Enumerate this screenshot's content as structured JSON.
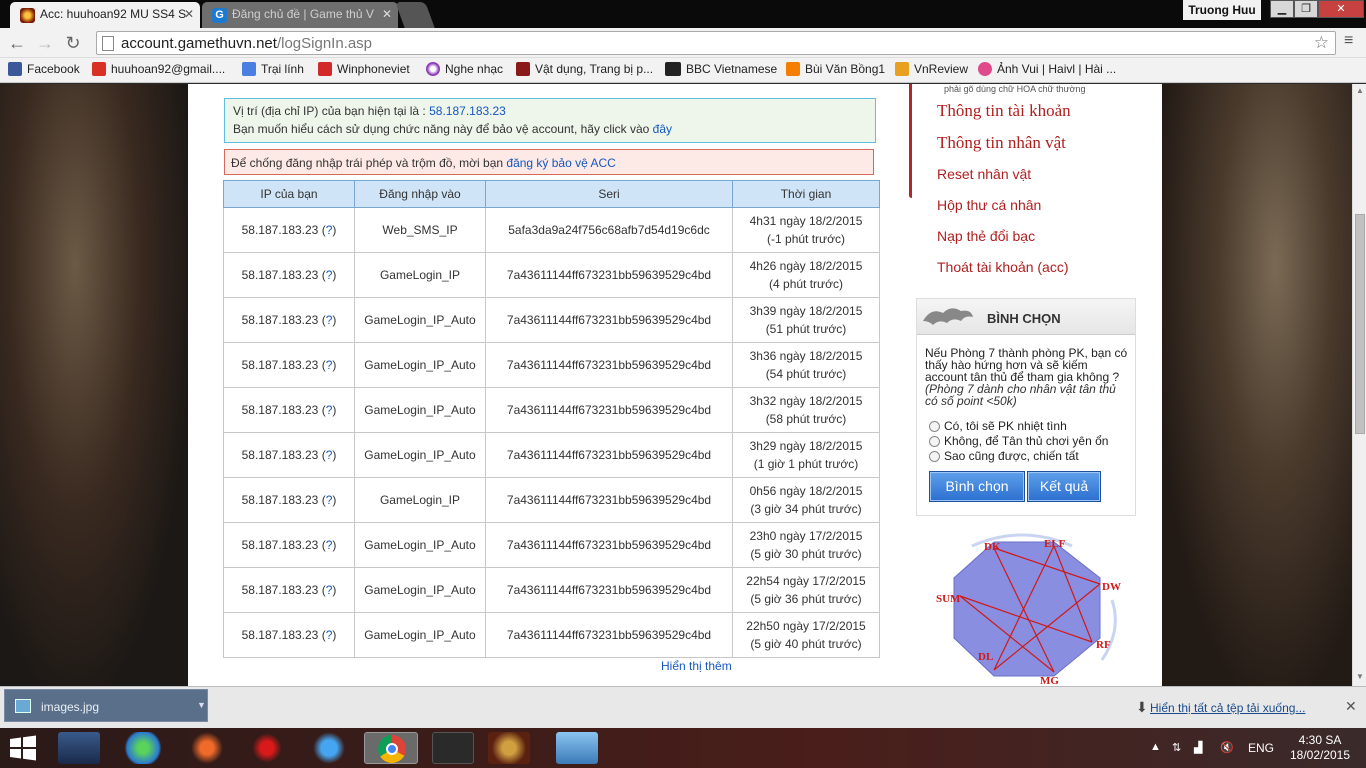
{
  "browser": {
    "tabs": [
      {
        "label": "Acc: huuhoan92 MU SS4 S",
        "active": true
      },
      {
        "label": "Đăng chủ đề | Game thủ V",
        "active": false
      }
    ],
    "user_badge": "Truong Huu",
    "url_host": "account.gamethuvn.net",
    "url_path": "/logSignIn.asp",
    "bookmarks": [
      "Facebook",
      "huuhoan92@gmail....",
      "Trại lính",
      "Winphoneviet",
      "Nghe nhạc",
      "Vật dụng, Trang bị p...",
      "BBC Vietnamese",
      "Bùi Văn Bồng1",
      "VnReview",
      "Ảnh Vui | Haivl | Hài ..."
    ]
  },
  "page": {
    "ip_notice_prefix": "Vị trí (địa chỉ IP) của bạn hiện tại là :",
    "ip_value": "58.187.183.23",
    "ip_notice_line2": "Bạn muốn hiểu cách sử dụng chức năng này để bảo vệ account, hãy click vào",
    "ip_notice_link": "đây",
    "warn_text": "Để chống đăng nhập trái phép và trộm đồ, mời bạn",
    "warn_link": "đăng ký bảo vệ ACC",
    "table": {
      "headers": [
        "IP của bạn",
        "Đăng nhập vào",
        "Seri",
        "Thời gian"
      ],
      "rows": [
        {
          "ip": "58.187.183.23",
          "q": "(?)",
          "login": "Web_SMS_IP",
          "seri": "5afa3da9a24f756c68afb7d54d19c6dc",
          "time": "4h31 ngày 18/2/2015",
          "ago": "(-1 phút trước)"
        },
        {
          "ip": "58.187.183.23",
          "q": "(?)",
          "login": "GameLogin_IP",
          "seri": "7a43611144ff673231bb59639529c4bd",
          "time": "4h26 ngày 18/2/2015",
          "ago": "(4 phút trước)"
        },
        {
          "ip": "58.187.183.23",
          "q": "(?)",
          "login": "GameLogin_IP_Auto",
          "seri": "7a43611144ff673231bb59639529c4bd",
          "time": "3h39 ngày 18/2/2015",
          "ago": "(51 phút trước)"
        },
        {
          "ip": "58.187.183.23",
          "q": "(?)",
          "login": "GameLogin_IP_Auto",
          "seri": "7a43611144ff673231bb59639529c4bd",
          "time": "3h36 ngày 18/2/2015",
          "ago": "(54 phút trước)"
        },
        {
          "ip": "58.187.183.23",
          "q": "(?)",
          "login": "GameLogin_IP_Auto",
          "seri": "7a43611144ff673231bb59639529c4bd",
          "time": "3h32 ngày 18/2/2015",
          "ago": "(58 phút trước)"
        },
        {
          "ip": "58.187.183.23",
          "q": "(?)",
          "login": "GameLogin_IP_Auto",
          "seri": "7a43611144ff673231bb59639529c4bd",
          "time": "3h29 ngày 18/2/2015",
          "ago": "(1 giờ 1 phút trước)"
        },
        {
          "ip": "58.187.183.23",
          "q": "(?)",
          "login": "GameLogin_IP",
          "seri": "7a43611144ff673231bb59639529c4bd",
          "time": "0h56 ngày 18/2/2015",
          "ago": "(3 giờ 34 phút trước)"
        },
        {
          "ip": "58.187.183.23",
          "q": "(?)",
          "login": "GameLogin_IP_Auto",
          "seri": "7a43611144ff673231bb59639529c4bd",
          "time": "23h0 ngày 17/2/2015",
          "ago": "(5 giờ 30 phút trước)"
        },
        {
          "ip": "58.187.183.23",
          "q": "(?)",
          "login": "GameLogin_IP_Auto",
          "seri": "7a43611144ff673231bb59639529c4bd",
          "time": "22h54 ngày 17/2/2015",
          "ago": "(5 giờ 36 phút trước)"
        },
        {
          "ip": "58.187.183.23",
          "q": "(?)",
          "login": "GameLogin_IP_Auto",
          "seri": "7a43611144ff673231bb59639529c4bd",
          "time": "22h50 ngày 17/2/2015",
          "ago": "(5 giờ 40 phút trước)"
        }
      ]
    },
    "show_more": "Hiển thị thêm"
  },
  "sidebar": {
    "note": "phải gõ dùng chữ HOA chữ thường",
    "links": [
      "Thông tin tài khoản",
      "Thông tin nhân vật",
      "Reset nhân vật",
      "Hộp thư cá nhân",
      "Nạp thẻ đổi bạc",
      "Thoát tài khoản (acc)"
    ],
    "poll": {
      "title": "BÌNH CHỌN",
      "question": "Nếu Phòng 7 thành phòng PK, bạn có thấy hào hứng hơn và sẽ kiếm account tân thủ để tham gia không ?",
      "note": "(Phòng 7 dành cho nhân vật tân thủ có số point <50k)",
      "options": [
        "Có, tôi sẽ PK nhiệt tình",
        "Không, để Tân thủ chơi yên ổn",
        "Sao cũng được, chiến tất"
      ],
      "vote_label": "Bình chọn",
      "result_label": "Kết quả"
    },
    "classes": [
      "DK",
      "ELF",
      "DW",
      "RF",
      "MG",
      "DL",
      "SUM"
    ]
  },
  "downloads": {
    "file": "images.jpg",
    "show_all": "Hiển thị tất cả tệp tải xuống..."
  },
  "taskbar": {
    "lang": "ENG",
    "time": "4:30 SA",
    "date": "18/02/2015"
  },
  "colors": {
    "accent_red": "#b02020",
    "link_blue": "#1558c0",
    "table_header": "#cfe4f7"
  }
}
